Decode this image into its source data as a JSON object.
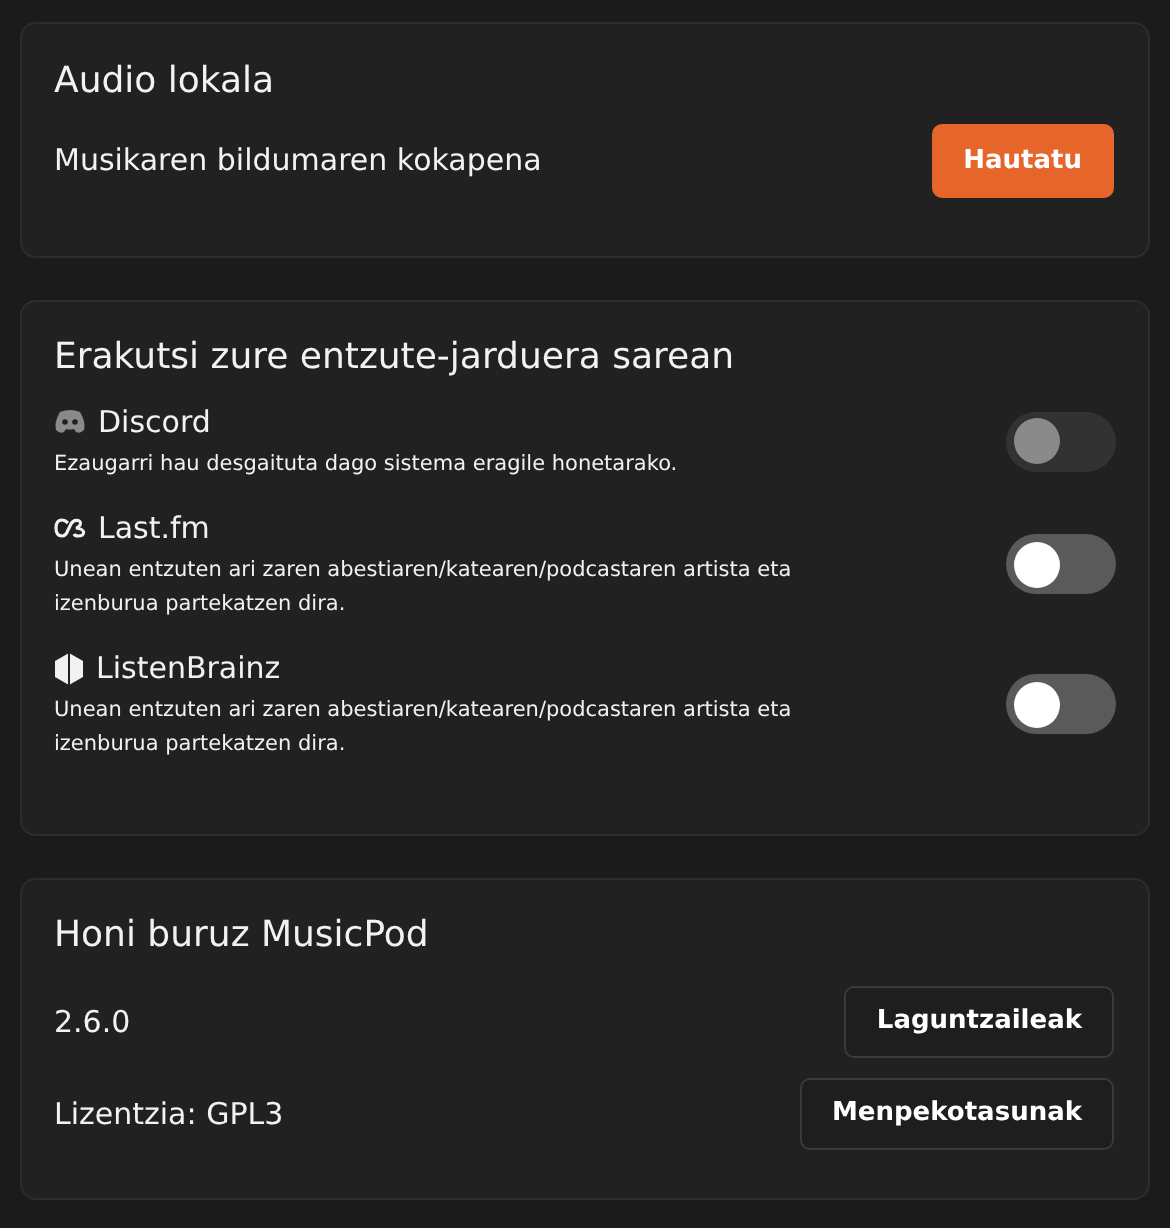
{
  "local_audio": {
    "title": "Audio lokala",
    "label": "Musikaren bildumaren kokapena",
    "button": "Hautatu"
  },
  "sharing": {
    "title": "Erakutsi zure entzute-jarduera sarean",
    "services": [
      {
        "name": "Discord",
        "description": "Ezaugarri hau desgaituta dago sistema eragile honetarako.",
        "on": false,
        "disabled": true
      },
      {
        "name": "Last.fm",
        "description": "Unean entzuten ari zaren abestiaren/katearen/podcastaren artista eta izenburua partekatzen dira.",
        "on": false,
        "disabled": false
      },
      {
        "name": "ListenBrainz",
        "description": "Unean entzuten ari zaren abestiaren/katearen/podcastaren artista eta izenburua partekatzen dira.",
        "on": false,
        "disabled": false
      }
    ]
  },
  "about": {
    "title": "Honi buruz MusicPod",
    "rows": [
      {
        "text": "2.6.0",
        "button": "Laguntzaileak"
      },
      {
        "text": "Lizentzia: GPL3",
        "button": "Menpekotasunak"
      }
    ]
  }
}
